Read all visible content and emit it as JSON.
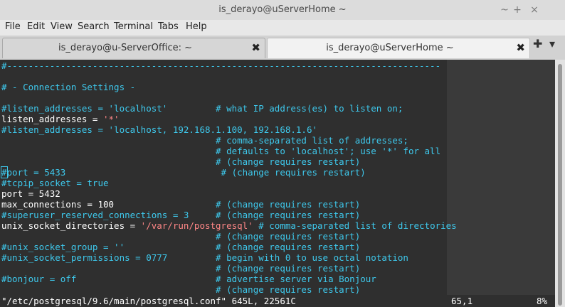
{
  "window": {
    "title": "is_derayo@uServerHome ~",
    "controls": [
      "~",
      "+",
      "×"
    ]
  },
  "menu": [
    "File",
    "Edit",
    "View",
    "Search",
    "Terminal",
    "Tabs",
    "Help"
  ],
  "tabs": [
    {
      "label": "is_derayo@u-ServerOffice: ~",
      "close": "✖",
      "active": false
    },
    {
      "label": "is_derayo@uServerHome ~",
      "close": "✖",
      "active": true
    }
  ],
  "tab_actions": {
    "new": "✚",
    "menu": "▾"
  },
  "terminal": {
    "lines": [
      [
        {
          "t": "#---------------------------------------------------------------------------------",
          "c": "c"
        }
      ],
      [],
      [
        {
          "t": "# - Connection Settings -",
          "c": "c"
        }
      ],
      [],
      [
        {
          "t": "#listen_addresses = 'localhost'         # what IP address(es) to listen on;",
          "c": "c"
        }
      ],
      [
        {
          "t": "listen_addresses = ",
          "c": "w"
        },
        {
          "t": "'*'",
          "c": "s"
        }
      ],
      [
        {
          "t": "#listen_addresses = 'localhost, 192.168.1.100, 192.168.1.6'",
          "c": "c"
        }
      ],
      [
        {
          "t": "                                        # comma-separated list of addresses;",
          "c": "c"
        }
      ],
      [
        {
          "t": "                                        # defaults to 'localhost'; use '*' for all",
          "c": "c"
        }
      ],
      [
        {
          "t": "                                        # (change requires restart)",
          "c": "c"
        }
      ],
      [
        {
          "t": "#",
          "c": "c",
          "cur": true
        },
        {
          "t": "port = 5433                             # (change requires restart)",
          "c": "c"
        }
      ],
      [
        {
          "t": "#tcpip_socket = true",
          "c": "c"
        }
      ],
      [
        {
          "t": "port = 5432",
          "c": "w"
        }
      ],
      [
        {
          "t": "max_connections = 100                   ",
          "c": "w"
        },
        {
          "t": "# (change requires restart)",
          "c": "c"
        }
      ],
      [
        {
          "t": "#superuser_reserved_connections = 3     # (change requires restart)",
          "c": "c"
        }
      ],
      [
        {
          "t": "unix_socket_directories = ",
          "c": "w"
        },
        {
          "t": "'/var/run/postgresql'",
          "c": "s"
        },
        {
          "t": " ",
          "c": "w"
        },
        {
          "t": "# comma-separated list of directories",
          "c": "c"
        }
      ],
      [
        {
          "t": "                                        # (change requires restart)",
          "c": "c"
        }
      ],
      [
        {
          "t": "#unix_socket_group = ''                 # (change requires restart)",
          "c": "c"
        }
      ],
      [
        {
          "t": "#unix_socket_permissions = 0777         # begin with 0 to use octal notation",
          "c": "c"
        }
      ],
      [
        {
          "t": "                                        # (change requires restart)",
          "c": "c"
        }
      ],
      [
        {
          "t": "#bonjour = off                          # advertise server via Bonjour",
          "c": "c"
        }
      ],
      [
        {
          "t": "                                        # (change requires restart)",
          "c": "c"
        }
      ]
    ],
    "status": {
      "file": "\"/etc/postgresql/9.6/main/postgresql.conf\" 645L, 22561C",
      "position": "65,1",
      "percent": "8%"
    }
  },
  "colors": {
    "comment": "#3ec9ed",
    "text": "#ffffff",
    "string": "#ff8787",
    "background": "#2f2f2f"
  }
}
